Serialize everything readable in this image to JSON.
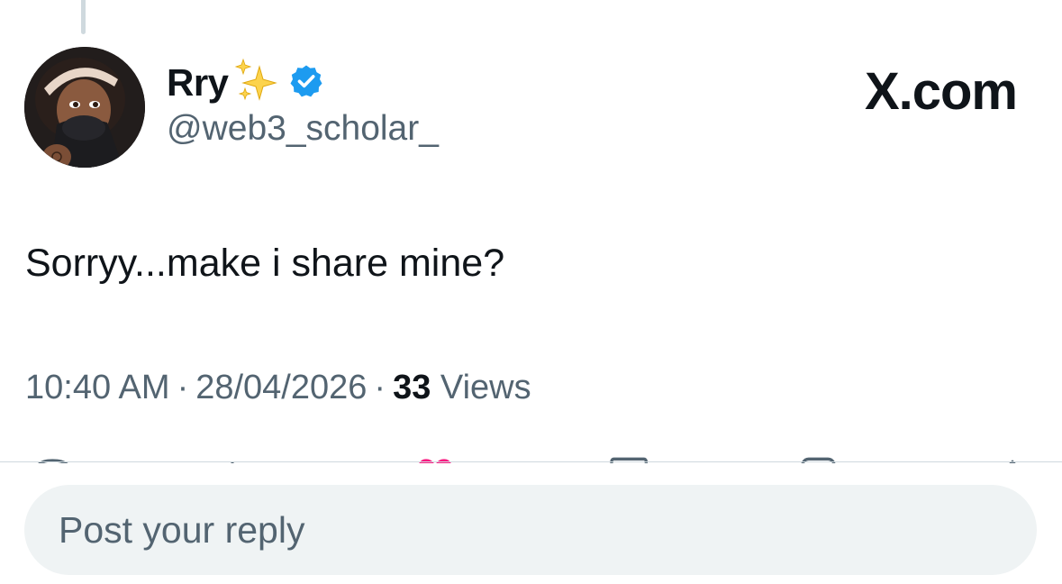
{
  "author": {
    "display_name": "Rry",
    "handle": "@web3_scholar_",
    "badge_icons": [
      "sparkles-icon",
      "verified-badge-icon"
    ],
    "verified_color": "#1d9bf0"
  },
  "brand": "X.com",
  "tweet": {
    "text": "Sorryy...make i share mine?",
    "time": "10:40 AM",
    "date": "28/04/2026",
    "separator": "·",
    "views_count": "33",
    "views_label": "Views"
  },
  "actions": [
    "reply-icon",
    "repost-icon",
    "like-icon",
    "bookmark-icon",
    "share-icon",
    "upload-icon"
  ],
  "reply_box": {
    "placeholder": "Post your reply"
  },
  "colors": {
    "text_primary": "#0f1419",
    "text_secondary": "#536471",
    "like_pink": "#f91880",
    "reply_box_bg": "#eff3f4"
  }
}
